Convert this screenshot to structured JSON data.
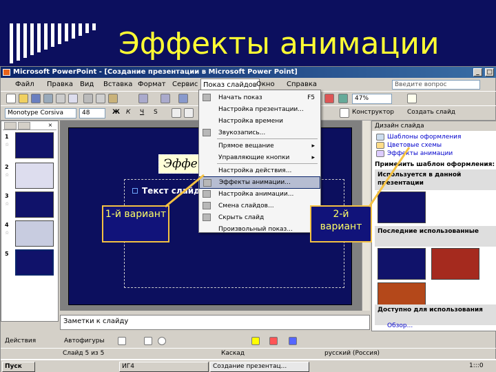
{
  "slide_title": "Эффекты анимации",
  "window": {
    "title": "Microsoft PowerPoint - [Создание презентации в Microsoft Power Point]"
  },
  "menubar": {
    "items": [
      "Файл",
      "Правка",
      "Вид",
      "Вставка",
      "Формат",
      "Сервис",
      "Показ слайдов",
      "Окно",
      "Справка"
    ],
    "active": "Показ слайдов",
    "ask_placeholder": "Введите вопрос"
  },
  "toolbar": {
    "zoom": "47%",
    "font": "Monotype Corsiva",
    "font_size": "48",
    "constructor_label": "Конструктор",
    "new_slide_label": "Создать слайд"
  },
  "thumbnails": {
    "tabs": [
      "",
      "×"
    ],
    "numbers": [
      "1",
      "2",
      "3",
      "4",
      "5"
    ]
  },
  "slide": {
    "title_placeholder": "Эффек",
    "body_placeholder": "Текст слайд"
  },
  "dropdown": {
    "items": [
      {
        "label": "Начать показ",
        "shortcut": "F5"
      },
      {
        "label": "Настройка презентации..."
      },
      {
        "label": "Настройка времени"
      },
      {
        "label": "Звукозапись..."
      },
      {
        "label": "Прямое вещание",
        "submenu": true
      },
      {
        "label": "Управляющие кнопки",
        "submenu": true
      },
      {
        "label": "Настройка действия..."
      },
      {
        "label": "Эффекты анимации...",
        "highlighted": true
      },
      {
        "label": "Настройка анимации..."
      },
      {
        "label": "Смена слайдов..."
      },
      {
        "label": "Скрыть слайд"
      },
      {
        "label": "Произвольный показ..."
      }
    ]
  },
  "taskpane": {
    "title": "Дизайн слайда",
    "links": [
      "Шаблоны оформления",
      "Цветовые схемы",
      "Эффекты анимации"
    ],
    "apply_label": "Применить шаблон оформления:",
    "group_used": "Используется в данной презентации",
    "group_recent": "Последние использованные",
    "group_available": "Доступно для использования",
    "browse": "Обзор..."
  },
  "notes": "Заметки к слайду",
  "draw_toolbar": {
    "actions": "Действия",
    "autoshapes": "Автофигуры"
  },
  "status": {
    "slide": "Слайд 5 из 5",
    "design": "Каскад",
    "language": "русский (Россия)"
  },
  "taskbar": {
    "start": "Пуск",
    "items": [
      "",
      "ИГ4",
      "Создание презентац..."
    ],
    "clock": "1:::0"
  },
  "callouts": {
    "variant1": "1-й вариант",
    "variant2": "2-й вариант"
  },
  "colors": {
    "slide_bg": "#0c0f5e",
    "title_yellow": "#ffff33",
    "callout_border": "#f5c242",
    "menu_highlight": "#b6bdd2"
  }
}
